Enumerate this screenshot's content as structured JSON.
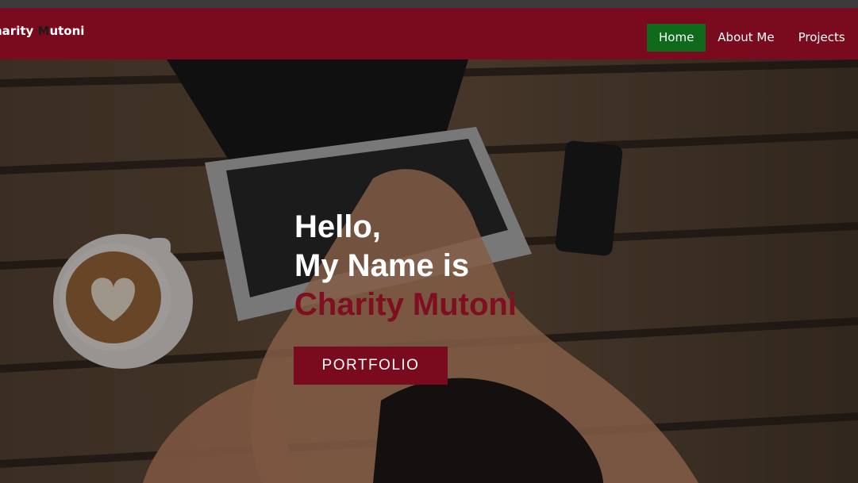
{
  "navbar": {
    "brand_part1": "harity ",
    "brand_accent": "M",
    "brand_part2": "utoni",
    "links": [
      {
        "label": "Home",
        "active": true
      },
      {
        "label": "About Me",
        "active": false
      },
      {
        "label": "Projects",
        "active": false
      }
    ]
  },
  "hero": {
    "greeting": "Hello,",
    "intro": "My Name is",
    "name": "Charity Mutoni",
    "button_label": "PORTFOLIO",
    "background_description_icon": "laptop-coffee-photo"
  },
  "colors": {
    "navbar": "#7a0b1e",
    "active_link": "#0f6b1b",
    "accent_name": "#7f0e20",
    "button": "#7a0b1e"
  }
}
